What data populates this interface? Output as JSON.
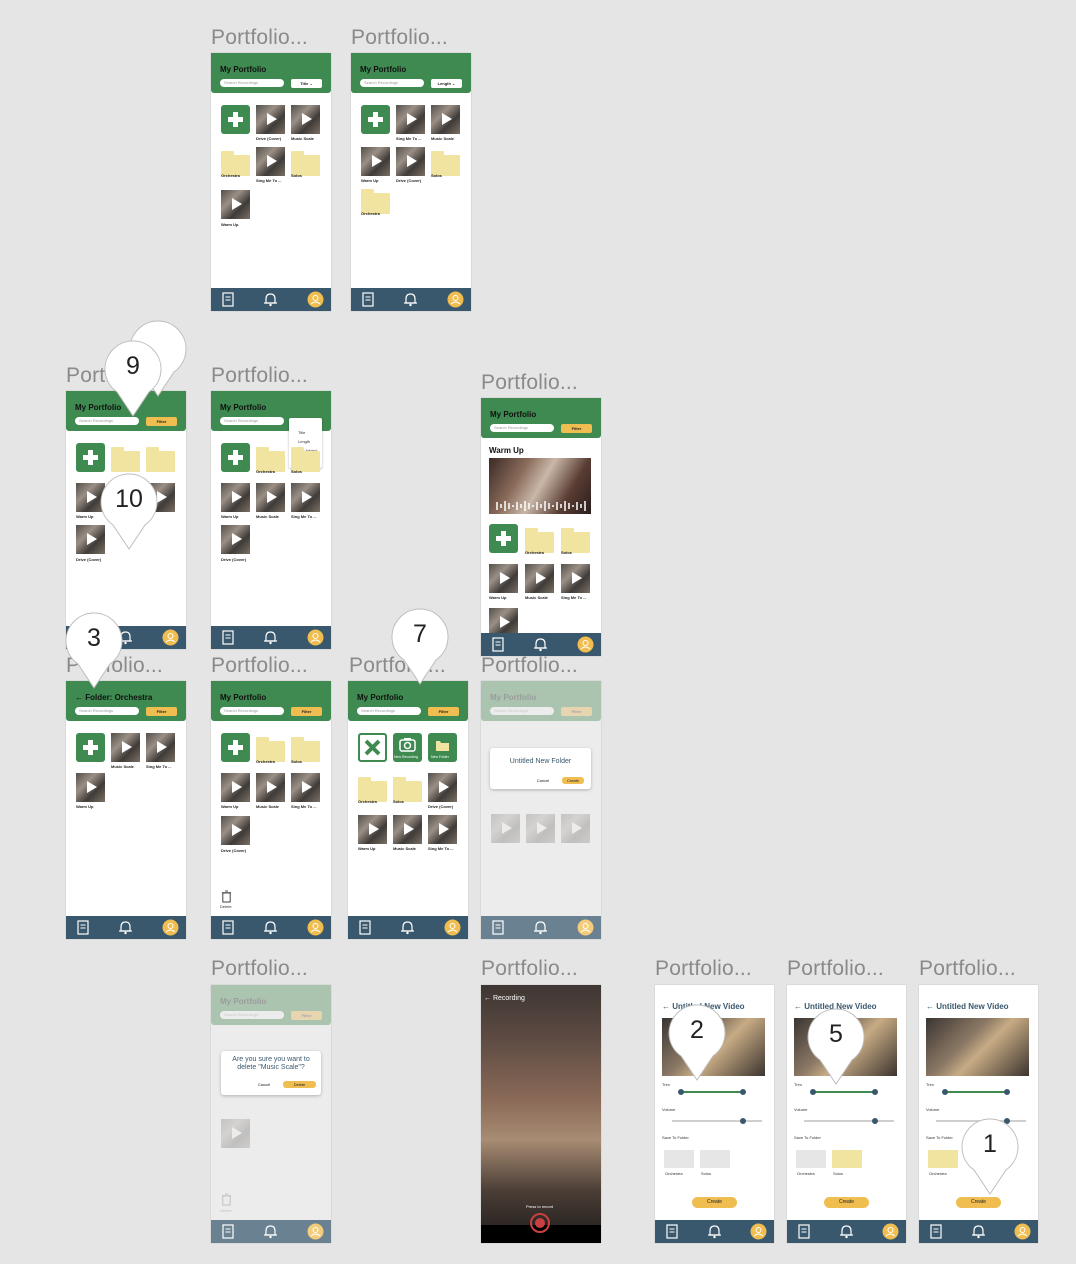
{
  "canvas": {
    "frame_name": "Portfolio..."
  },
  "common": {
    "header_title": "My Portfolio",
    "search_placeholder": "Search Recordings",
    "filter_label": "Filter",
    "add_icon": "plus-icon",
    "nav_icons": [
      "portfolio-icon",
      "bell-icon",
      "profile-icon"
    ]
  },
  "frames": {
    "f1": {
      "label": "Portfolio...",
      "sort": "Title ⌄",
      "items": [
        "Drive (Cover)",
        "Music Scale",
        "Orchestra",
        "Sing Me To ...",
        "Solos",
        "Warm Up"
      ]
    },
    "f2": {
      "label": "Portfolio...",
      "sort": "Length ⌄",
      "items": [
        "Sing Me To ...",
        "Music Scale",
        "Warm Up",
        "Drive (Cover)",
        "Solos",
        "Orchestra"
      ]
    },
    "f3": {
      "label": "Portfolio...",
      "items": [
        "Warm Up",
        "Drive (Cover)"
      ]
    },
    "f4": {
      "label": "Portfolio...",
      "dropdown": [
        "Title",
        "Length",
        "Date Added",
        "Filter"
      ],
      "items": [
        "Orchestra",
        "Solos",
        "Warm Up",
        "Music Scale",
        "Sing Me To ...",
        "Drive (Cover)"
      ]
    },
    "f5": {
      "label": "Portfolio...",
      "featured": "Warm Up",
      "items": [
        "Orchestra",
        "Solos",
        "Warm Up",
        "Music Scale",
        "Sing Me To ..."
      ]
    },
    "f6": {
      "label": "Portfolio...",
      "title": "Folder: Orchestra",
      "items": [
        "Music Scale",
        "Sing Me To ...",
        "Warm Up"
      ]
    },
    "f7": {
      "label": "Portfolio...",
      "items": [
        "Orchestra",
        "Solos",
        "Warm Up",
        "Music Scale",
        "Sing Me To ...",
        "Drive (Cover)"
      ],
      "delete": "Delete"
    },
    "f8": {
      "label": "Portfolio...",
      "actions": [
        "New Recording",
        "New Folder"
      ],
      "items": [
        "Orchestra",
        "Solos",
        "Drive (Cover)",
        "Warm Up",
        "Music Scale",
        "Sing Me To ..."
      ]
    },
    "f9": {
      "label": "Portfolio...",
      "modal_title": "Untitled New Folder",
      "cancel": "Cancel",
      "create": "Create"
    },
    "f10": {
      "label": "Portfolio...",
      "modal_title": "Are you sure you want to delete \"Music Scale\"?",
      "cancel": "Cancel",
      "confirm": "Delete",
      "delete": "Delete"
    },
    "f11": {
      "label": "Portfolio...",
      "title": "Recording",
      "hint": "Press to record"
    },
    "f12": {
      "label": "Portfolio...",
      "title": "Untitled New Video",
      "trim": "Trim",
      "volume": "Volume",
      "save_to": "Save To Folder",
      "folders": [
        "Orchestra",
        "Solos"
      ],
      "create": "Create"
    },
    "f13": {
      "label": "Portfolio...",
      "title": "Untitled New Video",
      "trim": "Trim",
      "volume": "Volume",
      "save_to": "Save To Folder",
      "folders": [
        "Orchestra",
        "Solos"
      ],
      "create": "Create"
    },
    "f14": {
      "label": "Portfolio...",
      "title": "Untitled New Video",
      "trim": "Trim",
      "volume": "Volume",
      "save_to": "Save To Folder",
      "folders": [
        "Orchestra"
      ],
      "create": "Create"
    }
  },
  "markers": [
    "9",
    "10",
    "3",
    "7",
    "2",
    "5",
    "1"
  ],
  "colors": {
    "header_green": "#3e8a50",
    "nav_blue": "#39586d",
    "accent_yellow": "#f0bd50",
    "folder_yellow": "#f1e3a0",
    "canvas": "#e5e5e5"
  }
}
